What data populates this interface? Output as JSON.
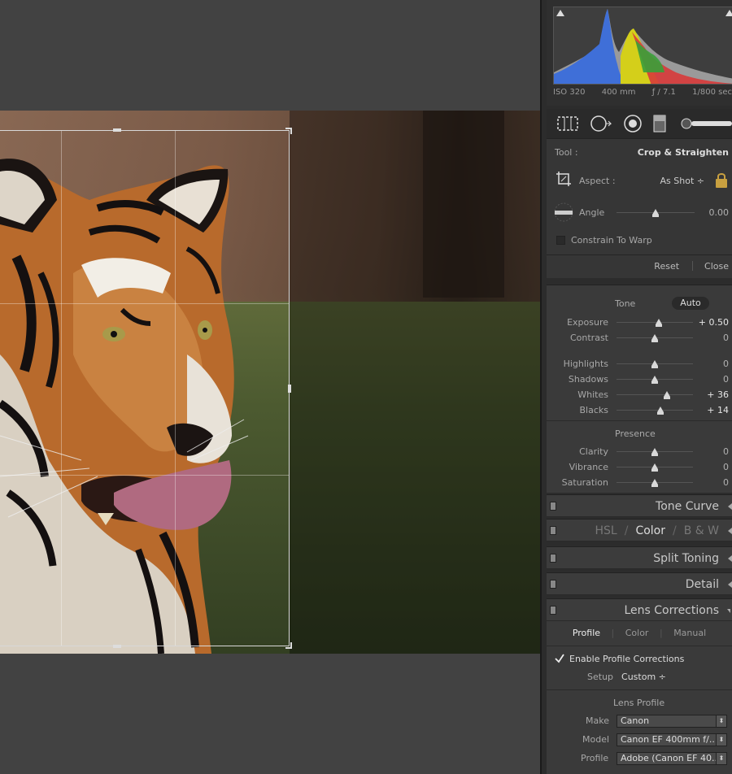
{
  "histogram": {
    "iso": "ISO 320",
    "focal": "400 mm",
    "aperture": "ƒ / 7.1",
    "shutter": "1/800 sec"
  },
  "crop_tool": {
    "tool_label": "Tool :",
    "tool_value": "Crop & Straighten",
    "aspect_label": "Aspect :",
    "aspect_value": "As Shot ÷",
    "angle_label": "Angle",
    "angle_value": "0.00",
    "angle_fraction": 0.5,
    "constrain_label": "Constrain To Warp",
    "reset_label": "Reset",
    "close_label": "Close"
  },
  "basic": {
    "tone_label": "Tone",
    "auto_label": "Auto",
    "presence_label": "Presence",
    "sliders": [
      {
        "label": "Exposure",
        "value": "+ 0.50",
        "bright": true,
        "pos": 0.55
      },
      {
        "label": "Contrast",
        "value": "0",
        "bright": false,
        "pos": 0.5
      },
      {
        "label": "Highlights",
        "value": "0",
        "bright": false,
        "pos": 0.5
      },
      {
        "label": "Shadows",
        "value": "0",
        "bright": false,
        "pos": 0.5
      },
      {
        "label": "Whites",
        "value": "+ 36",
        "bright": true,
        "pos": 0.66
      },
      {
        "label": "Blacks",
        "value": "+ 14",
        "bright": true,
        "pos": 0.57
      },
      {
        "label": "Clarity",
        "value": "0",
        "bright": false,
        "pos": 0.5
      },
      {
        "label": "Vibrance",
        "value": "0",
        "bright": false,
        "pos": 0.5
      },
      {
        "label": "Saturation",
        "value": "0",
        "bright": false,
        "pos": 0.5
      }
    ]
  },
  "panels": {
    "tone_curve": "Tone Curve",
    "hsl": "HSL",
    "color": "Color",
    "bw": "B & W",
    "split_toning": "Split Toning",
    "detail": "Detail",
    "lens_corrections": "Lens Corrections"
  },
  "lens": {
    "tab_profile": "Profile",
    "tab_color": "Color",
    "tab_manual": "Manual",
    "enable_label": "Enable Profile Corrections",
    "setup_label": "Setup",
    "setup_value": "Custom ÷",
    "lens_profile_label": "Lens Profile",
    "make_label": "Make",
    "make_value": "Canon",
    "model_label": "Model",
    "model_value": "Canon EF 400mm f/...",
    "profile_label": "Profile",
    "profile_value": "Adobe (Canon EF 40..."
  }
}
